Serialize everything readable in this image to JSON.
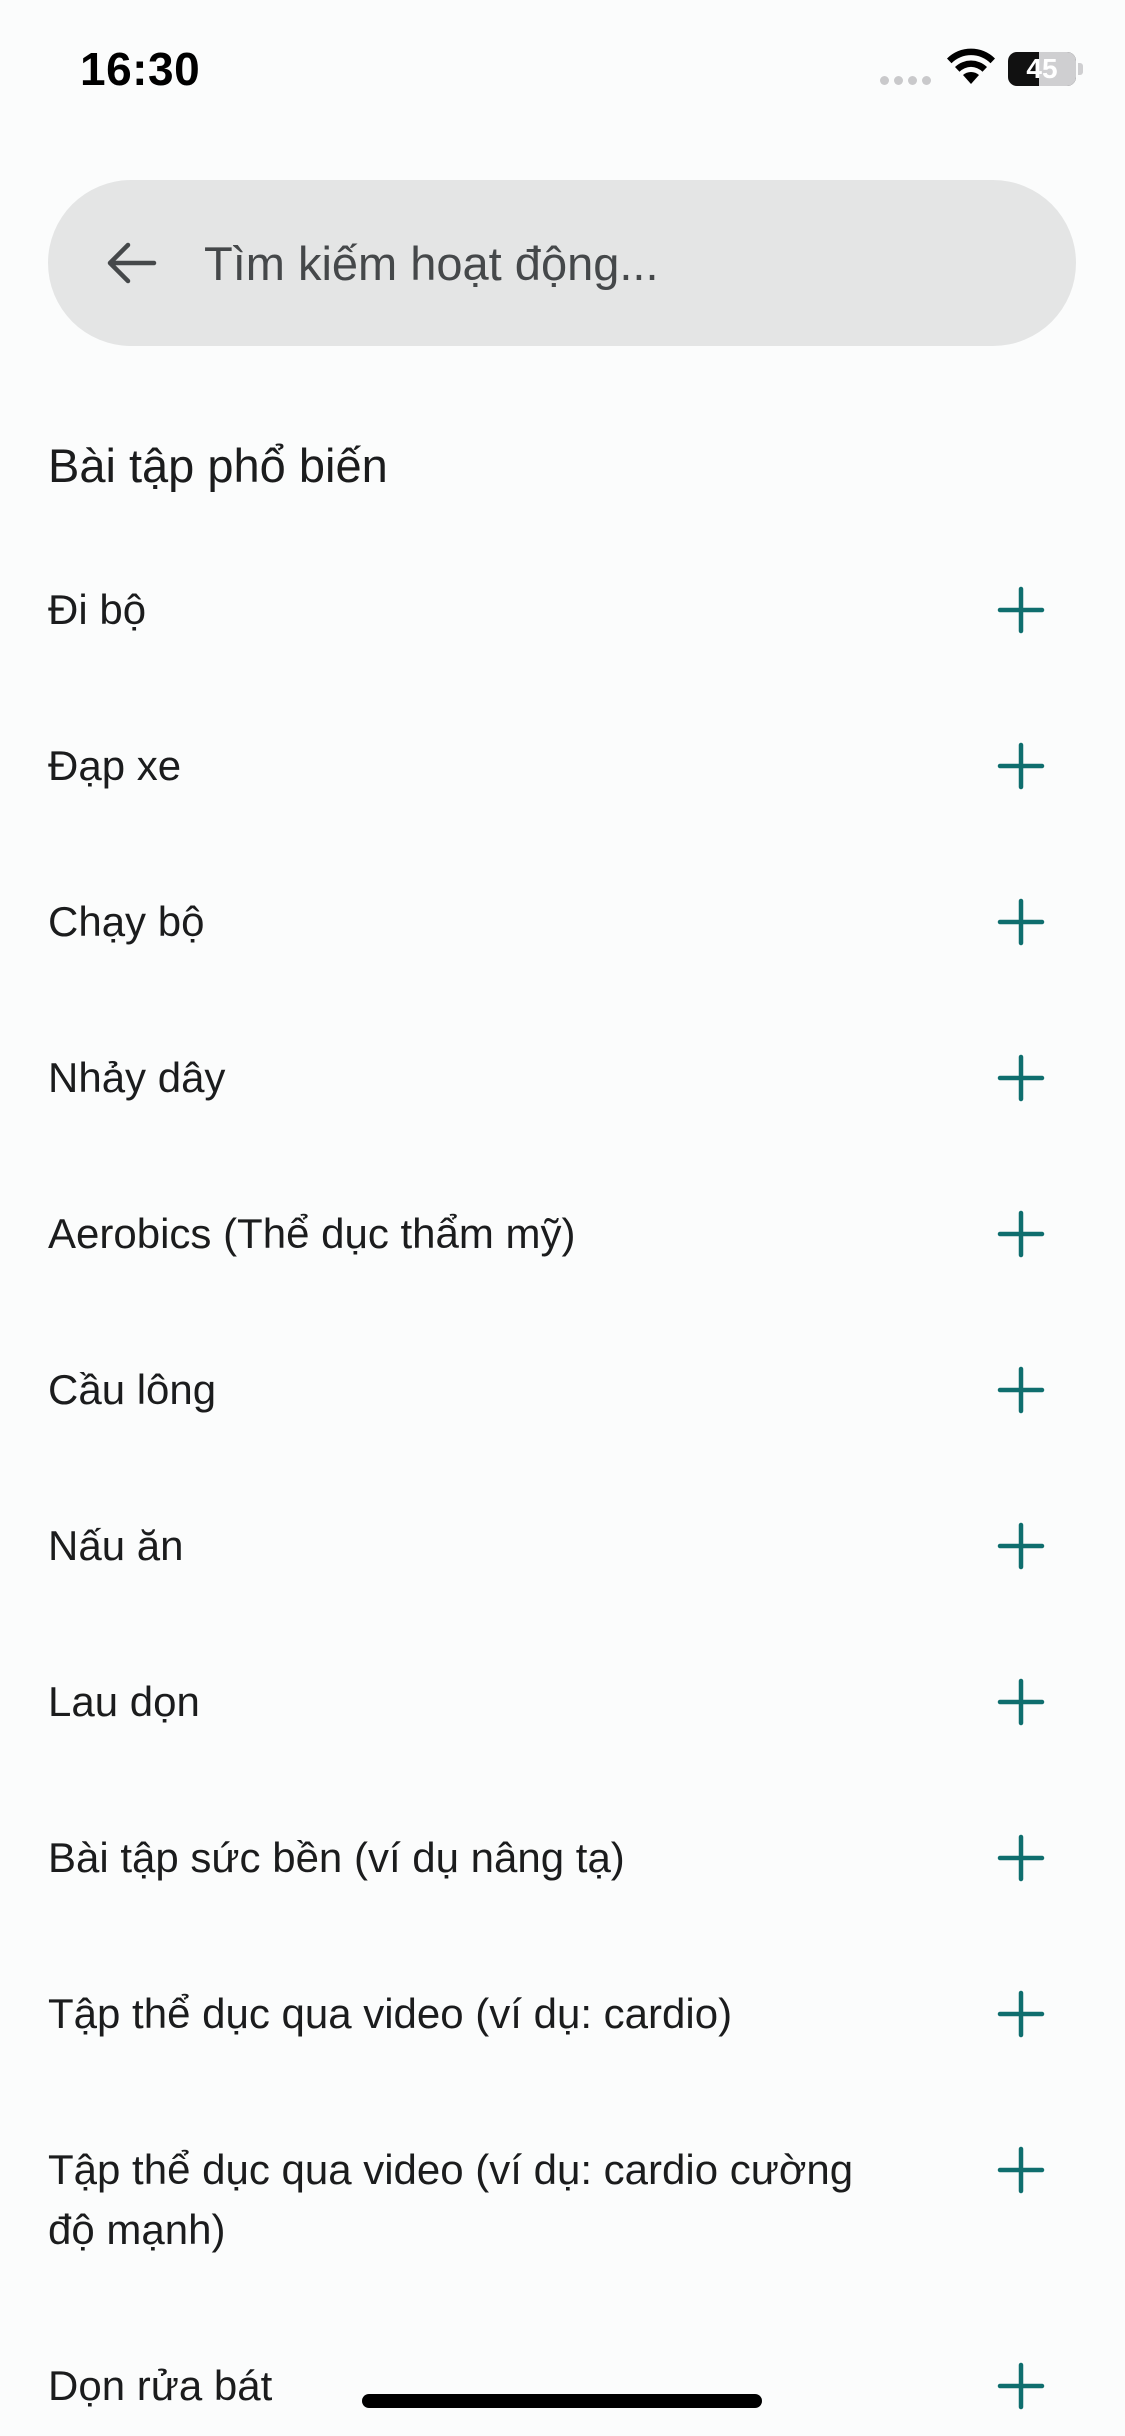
{
  "status_bar": {
    "time": "16:30",
    "battery": "45"
  },
  "search": {
    "placeholder": "Tìm kiếm hoạt động..."
  },
  "section": {
    "title": "Bài tập phổ biến"
  },
  "activities": [
    "Đi bộ",
    "Đạp xe",
    "Chạy bộ",
    "Nhảy dây",
    "Aerobics (Thể dục thẩm mỹ)",
    "Cầu lông",
    "Nấu ăn",
    "Lau dọn",
    "Bài tập sức bền (ví dụ nâng tạ)",
    "Tập thể dục qua video (ví dụ: cardio)",
    "Tập thể dục qua video (ví dụ: cardio cường độ mạnh)",
    "Dọn rửa bát"
  ],
  "icons": {
    "back": "arrow-left-icon",
    "add": "plus-icon",
    "wifi": "wifi-icon",
    "signal": "cellular-signal-icon",
    "battery": "battery-icon"
  },
  "colors": {
    "accent": "#0f6e6e",
    "background": "#fbfcfc",
    "search_background": "#e4e5e5"
  }
}
